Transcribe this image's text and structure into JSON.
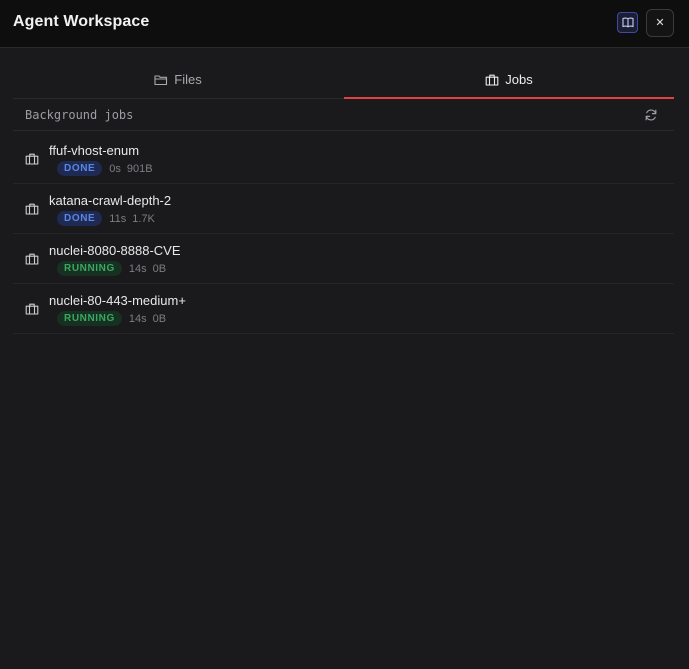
{
  "window": {
    "title": "Agent Workspace"
  },
  "header": {
    "docs_icon": "book-icon",
    "close_label": "✕"
  },
  "tabs": [
    {
      "label": "Files",
      "icon": "folder-icon",
      "active": false
    },
    {
      "label": "Jobs",
      "icon": "briefcase-icon",
      "active": true
    }
  ],
  "accent_color": "#e0433f",
  "section": {
    "title": "Background jobs",
    "refresh_icon": "refresh-icon"
  },
  "jobs": [
    {
      "name": "ffuf-vhost-enum",
      "status": "DONE",
      "duration": "0s",
      "size": "901B"
    },
    {
      "name": "katana-crawl-depth-2",
      "status": "DONE",
      "duration": "11s",
      "size": "1.7K"
    },
    {
      "name": "nuclei-8080-8888-CVE",
      "status": "RUNNING",
      "duration": "14s",
      "size": "0B"
    },
    {
      "name": "nuclei-80-443-medium+",
      "status": "RUNNING",
      "duration": "14s",
      "size": "0B"
    }
  ],
  "status_colors": {
    "DONE": "#5b86e6",
    "RUNNING": "#3ba85f"
  }
}
